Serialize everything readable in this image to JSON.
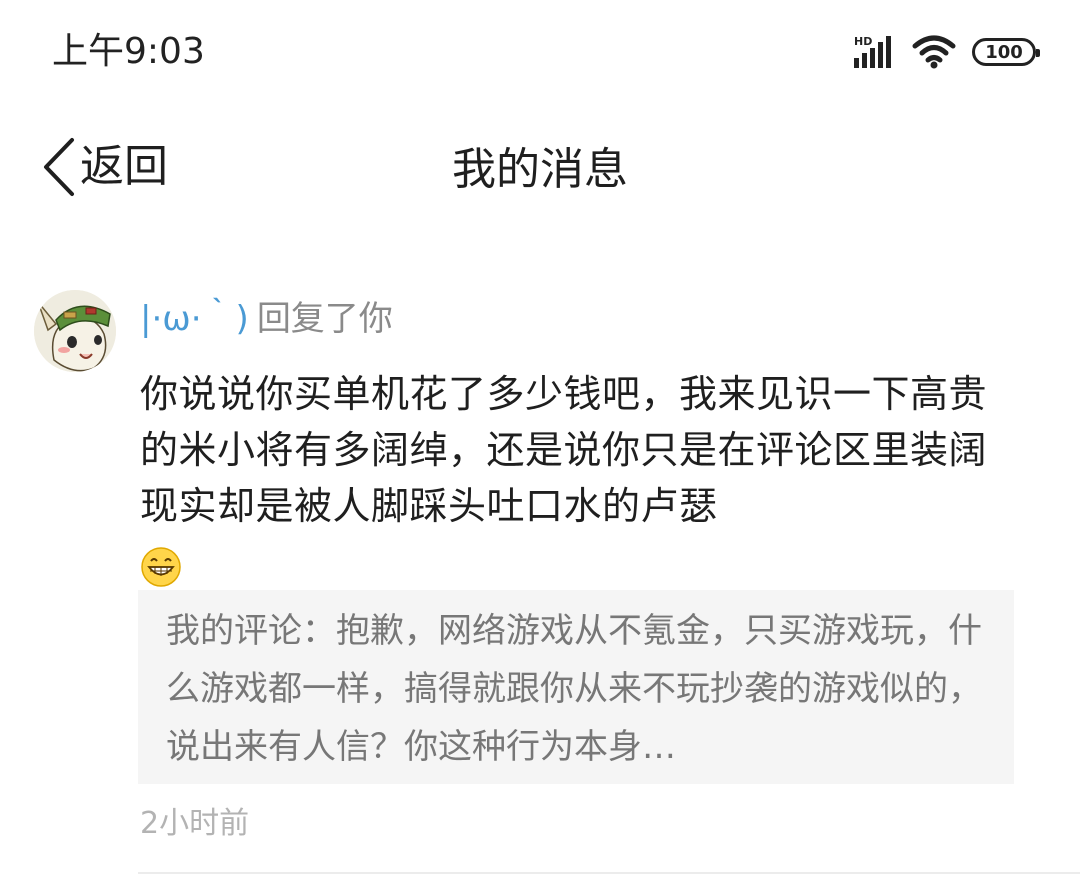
{
  "status_bar": {
    "time": "上午9:03",
    "network_label": "HD",
    "battery": "100",
    "icons": [
      "signal-icon",
      "wifi-icon",
      "battery-icon"
    ]
  },
  "header": {
    "back_label": "返回",
    "title": "我的消息"
  },
  "message": {
    "username": "|·ω·｀)",
    "action": "回复了你",
    "body": "你说说你买单机花了多少钱吧，我来见识一下高贵的米小将有多阔绰，还是说你只是在评论区里装阔现实却是被人脚踩头吐口水的卢瑟",
    "emoji": "grinning-emoji",
    "quote_label": "我的评论：",
    "quote_text": "抱歉，网络游戏从不氪金，只买游戏玩，什么游戏都一样，搞得就跟你从来不玩抄袭的游戏似的，说出来有人信？你这种行为本身…",
    "time_ago": "2小时前"
  },
  "colors": {
    "username": "#4a9ad4",
    "muted_text": "#8a8a8a",
    "quote_bg": "#f5f5f5",
    "timestamp": "#b3b3b3"
  }
}
